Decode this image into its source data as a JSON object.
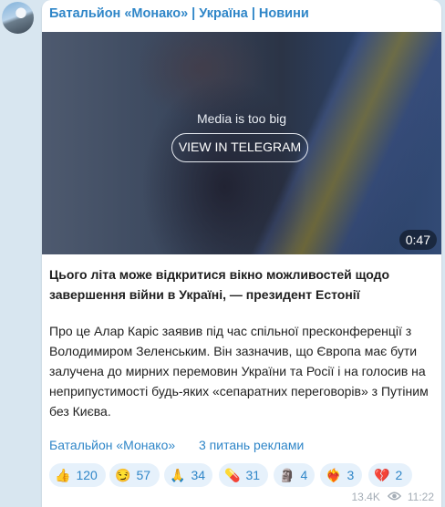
{
  "channel_name": "Батальйон «Монако» | Україна | Новини",
  "media": {
    "message": "Media is too big",
    "button_label": "VIEW IN TELEGRAM",
    "duration": "0:47"
  },
  "post": {
    "headline": "Цього літа може відкритися вікно можливостей щодо завершення війни в Україні, — президент Естонії",
    "body": "Про це Алар Каріс заявив під час спільної пресконференції з Володимиром Зеленським. Він зазначив, що Європа має бути залучена до мирних перемовин України та Росії і на голосив на неприпустимості будь-яких «сепаратних переговорів» з Путіним без Києва."
  },
  "links": {
    "channel": "Батальйон «Монако»",
    "ads": "3 питань реклами"
  },
  "reactions": [
    {
      "icon": "thumbs-up-icon",
      "emoji": "👍",
      "count": "120"
    },
    {
      "icon": "smirk-face-icon",
      "emoji": "😏",
      "count": "57"
    },
    {
      "icon": "folded-hands-icon",
      "emoji": "🙏",
      "count": "34"
    },
    {
      "icon": "pill-icon",
      "emoji": "💊",
      "count": "31"
    },
    {
      "icon": "moai-icon",
      "emoji": "🗿",
      "count": "4"
    },
    {
      "icon": "heart-on-fire-icon",
      "emoji": "❤️‍🔥",
      "count": "3"
    },
    {
      "icon": "broken-heart-icon",
      "emoji": "💔",
      "count": "2"
    }
  ],
  "meta": {
    "views": "13.4K",
    "time": "11:22"
  },
  "colors": {
    "link": "#2f86c8",
    "reaction_bg": "#e6f1fb",
    "chat_bg": "#d8e6f0"
  }
}
